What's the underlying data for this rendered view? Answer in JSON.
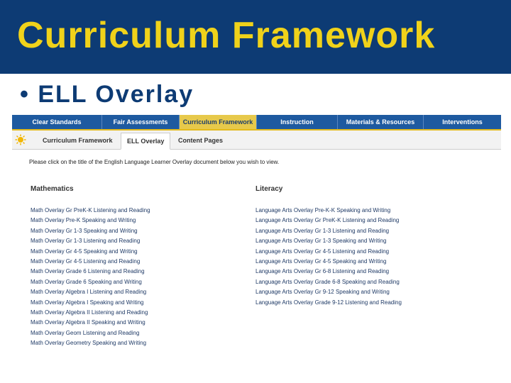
{
  "slide": {
    "title": "Curriculum Framework",
    "bullet": "• ELL Overlay"
  },
  "nav_primary": {
    "items": [
      {
        "label": "Clear Standards",
        "active": false
      },
      {
        "label": "Fair Assessments",
        "active": false
      },
      {
        "label": "Curriculum Framework",
        "active": true
      },
      {
        "label": "Instruction",
        "active": false
      },
      {
        "label": "Materials & Resources",
        "active": false
      },
      {
        "label": "Interventions",
        "active": false
      }
    ]
  },
  "nav_secondary": {
    "icon": "sun-logo-icon",
    "tabs": [
      {
        "label": "Curriculum Framework",
        "active": false
      },
      {
        "label": "ELL Overlay",
        "active": true
      },
      {
        "label": "Content Pages",
        "active": false
      }
    ]
  },
  "content": {
    "instruction": "Please click on the title of the English Language Learner Overlay document below you wish to view.",
    "mathematics": {
      "heading": "Mathematics",
      "links": [
        "Math Overlay Gr PreK-K Listening and Reading",
        "Math Overlay Pre-K Speaking and Writing",
        "Math Overlay Gr 1-3 Speaking and Writing",
        "Math Overlay Gr 1-3 Listening and Reading",
        "Math Overlay Gr 4-5 Speaking and Writing",
        "Math Overlay Gr 4-5 Listening and Reading",
        "Math Overlay Grade 6 Listening and Reading",
        "Math Overlay Grade 6 Speaking and Writing",
        "Math Overlay Algebra I Listening and Reading",
        "Math Overlay Algebra I Speaking and Writing",
        "Math Overlay Algebra II Listening and Reading",
        "Math Overlay Algebra II Speaking and Writing",
        "Math Overlay Geom Listening and Reading",
        "Math Overlay Geometry Speaking and Writing"
      ]
    },
    "literacy": {
      "heading": "Literacy",
      "links": [
        "Language Arts Overlay Pre-K-K Speaking and Writing",
        "Language Arts Overlay Gr PreK-K Listening and Reading",
        "Language Arts Overlay Gr 1-3 Listening and Reading",
        "Language Arts Overlay Gr 1-3 Speaking and Writing",
        "Language Arts Overlay Gr 4-5 Listening and Reading",
        "Language Arts Overlay Gr 4-5 Speaking and Writing",
        "Language Arts Overlay Gr 6-8 Listening and Reading",
        "Language Arts Overlay Grade 6-8 Speaking and Reading",
        "Language Arts Overlay Gr 9-12 Speaking and Writing",
        "Language Arts Overlay Grade 9-12 Listening and Reading"
      ]
    }
  },
  "colors": {
    "title_bar": "#0d3b74",
    "title_text": "#f0d21a",
    "nav_primary_bg": "#1e5aa0",
    "nav_active_bg": "#e7c94b",
    "link": "#1f3a66"
  }
}
